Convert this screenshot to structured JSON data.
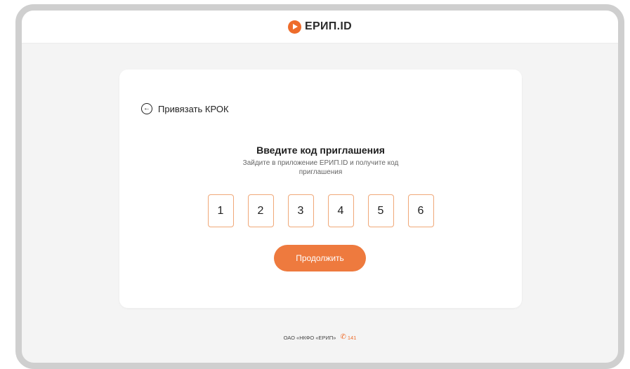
{
  "header": {
    "brand": "ЕРИП.ID",
    "logo_icon": "erip-play-icon",
    "accent_color": "#ee6c2b"
  },
  "card": {
    "back_label": "Привязать КРОК",
    "title": "Введите код приглашения",
    "subtitle": "Зайдите в приложение ЕРИП.ID и получите код приглашения",
    "code_digits": [
      "1",
      "2",
      "3",
      "4",
      "5",
      "6"
    ],
    "continue_label": "Продолжить"
  },
  "footer": {
    "company": "ОАО «НКФО «ЕРИП»",
    "phone_icon": "phone-icon",
    "phone": "141"
  }
}
